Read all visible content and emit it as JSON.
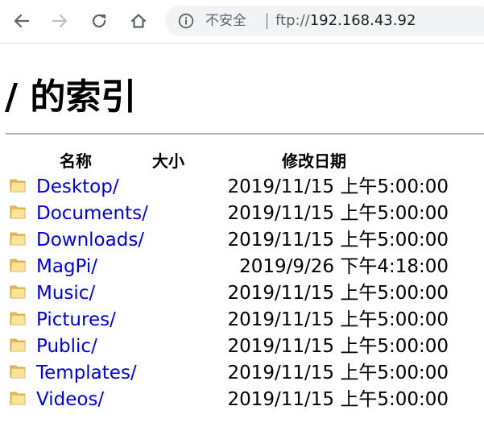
{
  "browser": {
    "icons": {
      "back": "arrow-left-icon",
      "forward": "arrow-right-icon",
      "reload": "reload-icon",
      "home": "home-icon",
      "info": "info-icon"
    },
    "security_label": "不安全",
    "url_scheme": "ftp://",
    "url_host": "192.168.43.92"
  },
  "page": {
    "title": "/ 的索引",
    "columns": {
      "name": "名称",
      "size": "大小",
      "date": "修改日期"
    },
    "folder_icon": "folder-icon",
    "colors": {
      "link": "#0000cc",
      "folder_body": "#e8b94a",
      "folder_light": "#fbe39a"
    },
    "rows": [
      {
        "name": "Desktop/",
        "size": "",
        "date": "2019/11/15 上午5:00:00"
      },
      {
        "name": "Documents/",
        "size": "",
        "date": "2019/11/15 上午5:00:00"
      },
      {
        "name": "Downloads/",
        "size": "",
        "date": "2019/11/15 上午5:00:00"
      },
      {
        "name": "MagPi/",
        "size": "",
        "date": "2019/9/26 下午4:18:00"
      },
      {
        "name": "Music/",
        "size": "",
        "date": "2019/11/15 上午5:00:00"
      },
      {
        "name": "Pictures/",
        "size": "",
        "date": "2019/11/15 上午5:00:00"
      },
      {
        "name": "Public/",
        "size": "",
        "date": "2019/11/15 上午5:00:00"
      },
      {
        "name": "Templates/",
        "size": "",
        "date": "2019/11/15 上午5:00:00"
      },
      {
        "name": "Videos/",
        "size": "",
        "date": "2019/11/15 上午5:00:00"
      }
    ]
  }
}
